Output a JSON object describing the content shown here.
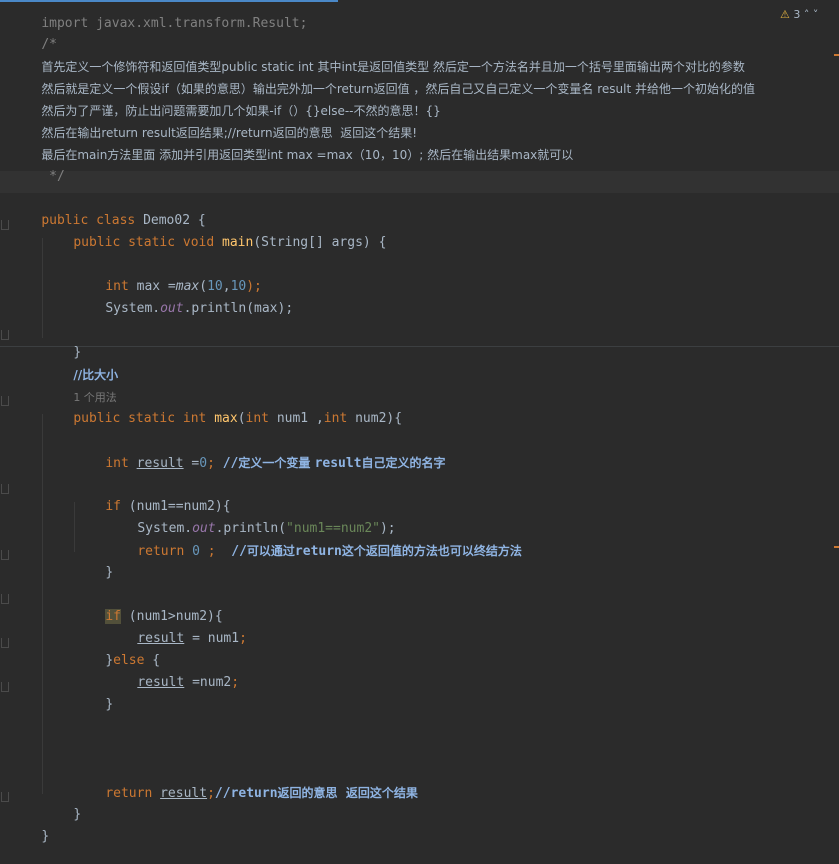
{
  "header": {
    "warning_count": "3"
  },
  "lines": {
    "import": "import javax.xml.transform.Result;",
    "c_open": "/*",
    "c1": "首先定义一个修饰符和返回值类型public static int 其中int是返回值类型 然后定一个方法名并且加一个括号里面输出两个对比的参数",
    "c2": "然后就是定义一个假设if（如果的意思）输出完外加一个return返回值 ，然后自己又自己定义一个变量名 result 并给他一个初始化的值",
    "c3": "然后为了严谨，防止出问题需要加几个如果-if（）{}else--不然的意思！{}",
    "c4": "然后在输出return result返回结果;//return返回的意思  返回这个结果!",
    "c5": "最后在main方法里面 添加并引用返回类型int max =max（10，10）; 然后在输出结果max就可以",
    "c_close": " */",
    "class_kw": "public class ",
    "class_name": "Demo02 {",
    "main_kw": "public static void ",
    "main_name": "main",
    "main_args": "(String[] args) {",
    "int_kw": "int",
    "max_decl": " max =",
    "max_call": "max",
    "max_paren_open": "(",
    "num10a": "10",
    "comma": ",",
    "num10b": "10",
    "max_paren_close": ");",
    "sys": "System.",
    "out": "out",
    "println_max": ".println(max);",
    "close_brace": "}",
    "cmt_compare": "//比大小",
    "usages": "1 个用法",
    "max_sig_kw": "public static int ",
    "max_sig_name": "max",
    "max_sig_p1": "(",
    "max_sig_int1": "int",
    "max_sig_num1": " num1 ,",
    "max_sig_int2": "int",
    "max_sig_num2": " num2){",
    "res_int": "int ",
    "res_name": "result",
    "res_eq": " =",
    "res_zero": "0",
    "res_semi": ";",
    "res_cmt_slash": " //",
    "res_cmt_a": "定义一个变量 ",
    "res_cmt_b": "result",
    "res_cmt_c": "自己定义的名字",
    "if1_kw": "if",
    "if1_cond": " (num1==num2){",
    "sys2": "System.",
    "out2": "out",
    "println2": ".println(",
    "str2": "\"num1==num2\"",
    "println2_end": ");",
    "ret0_kw": "return ",
    "ret0_num": "0",
    "ret0_semi": " ;",
    "ret0_cmt_slash": "  //",
    "ret0_cmt_a": "可以通过",
    "ret0_cmt_b": "return",
    "ret0_cmt_c": "这个返回值的方法也可以终结方法",
    "close2": "}",
    "if2_kw": "if",
    "if2_cond": " (num1>num2){",
    "res_a": "result",
    "res_a_eq": " = num1",
    "res_a_semi": ";",
    "else_open": "}",
    "else_kw": "else",
    "else_brace": " {",
    "res_b": "result",
    "res_b_eq": " =num2",
    "res_b_semi": ";",
    "close3": "}",
    "ret_kw": "return ",
    "ret_name": "result",
    "ret_semi": ";",
    "ret_cmt_slash": "//",
    "ret_cmt_a": "return",
    "ret_cmt_b": "返回的意思  返回这个结果",
    "close4": "}",
    "close5": "}"
  },
  "colors": {
    "background": "#2b2b2b",
    "keyword": "#cc7832",
    "number": "#6897bb",
    "string": "#6a8759",
    "method": "#ffc66d",
    "comment": "#808080"
  }
}
